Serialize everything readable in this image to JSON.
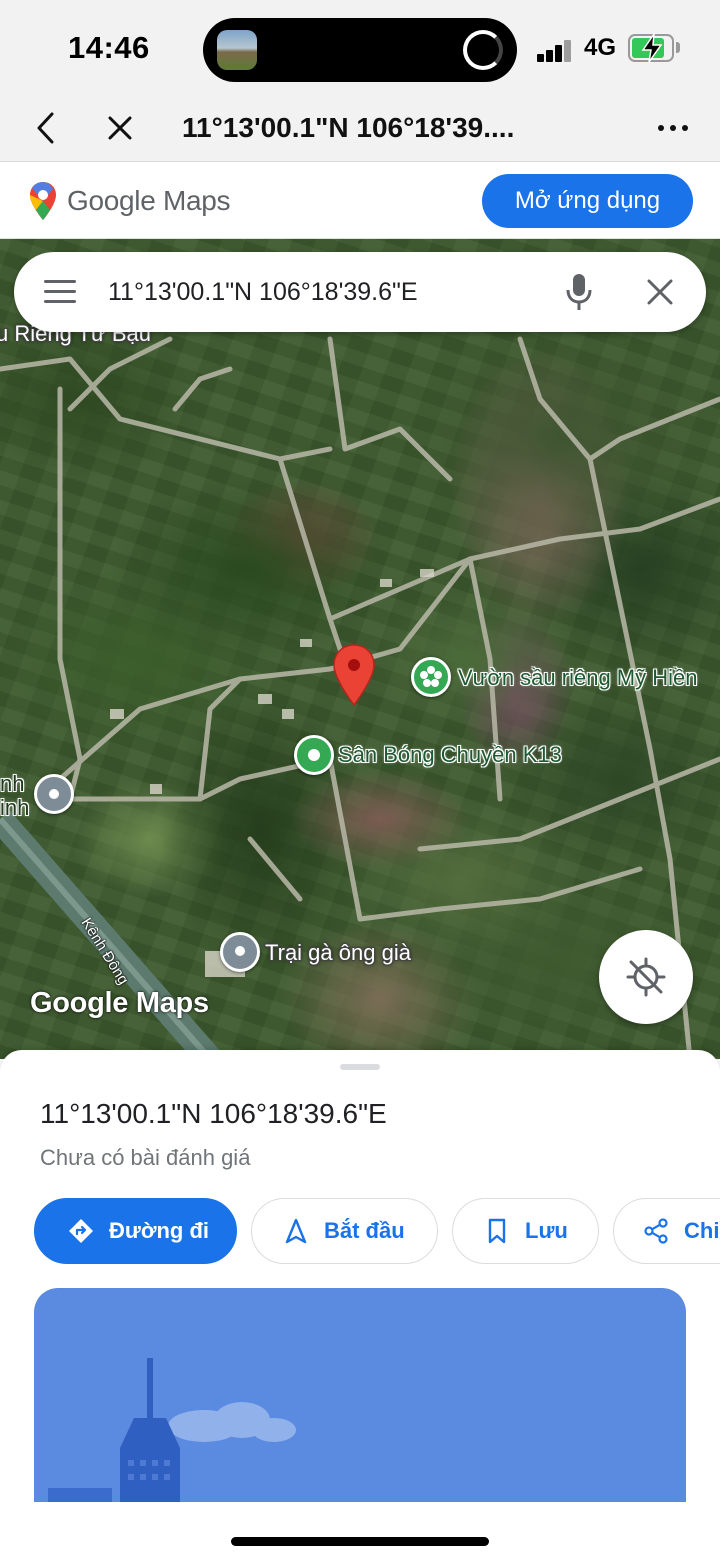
{
  "status_bar": {
    "time": "14:46",
    "network": "4G",
    "battery_level": 0.75,
    "charging": true
  },
  "browser": {
    "page_title": "11°13'00.1\"N 106°18'39....",
    "back_icon": "chevron-left-icon",
    "close_icon": "close-icon",
    "more_icon": "more-horizontal-icon"
  },
  "maps_banner": {
    "logo_text": "Google Maps",
    "open_app_label": "Mở ứng dụng"
  },
  "search": {
    "query": "11°13'00.1\"N 106°18'39.6\"E",
    "menu_icon": "menu-icon",
    "mic_icon": "mic-icon",
    "clear_icon": "close-icon"
  },
  "map": {
    "labels": {
      "top_left_partial": "u Riêng Tư Bạu",
      "durian_garden": "Vườn sầu riêng Mỹ Hiền",
      "volleyball_court": "Sân Bóng Chuyền K13",
      "chicken_farm": "Trại gà ông già",
      "left_partial_1": "nh",
      "left_partial_2": "inh",
      "canal": "Kênh Đông"
    },
    "watermark": "Google Maps",
    "colors": {
      "pin_red": "#ea4335",
      "poi_green": "#34a853",
      "poi_gray": "#7d8c97"
    }
  },
  "place": {
    "title": "11°13'00.1\"N 106°18'39.6\"E",
    "subtitle": "Chưa có bài đánh giá",
    "actions": [
      {
        "label": "Đường đi",
        "icon": "directions-icon"
      },
      {
        "label": "Bắt đầu",
        "icon": "navigation-arrow-icon"
      },
      {
        "label": "Lưu",
        "icon": "bookmark-icon"
      },
      {
        "label": "Chi",
        "icon": "share-icon"
      }
    ]
  },
  "theme": {
    "accent": "#1a73e8",
    "text_secondary": "#70757a",
    "chrome_bg": "#f2f2f2"
  }
}
